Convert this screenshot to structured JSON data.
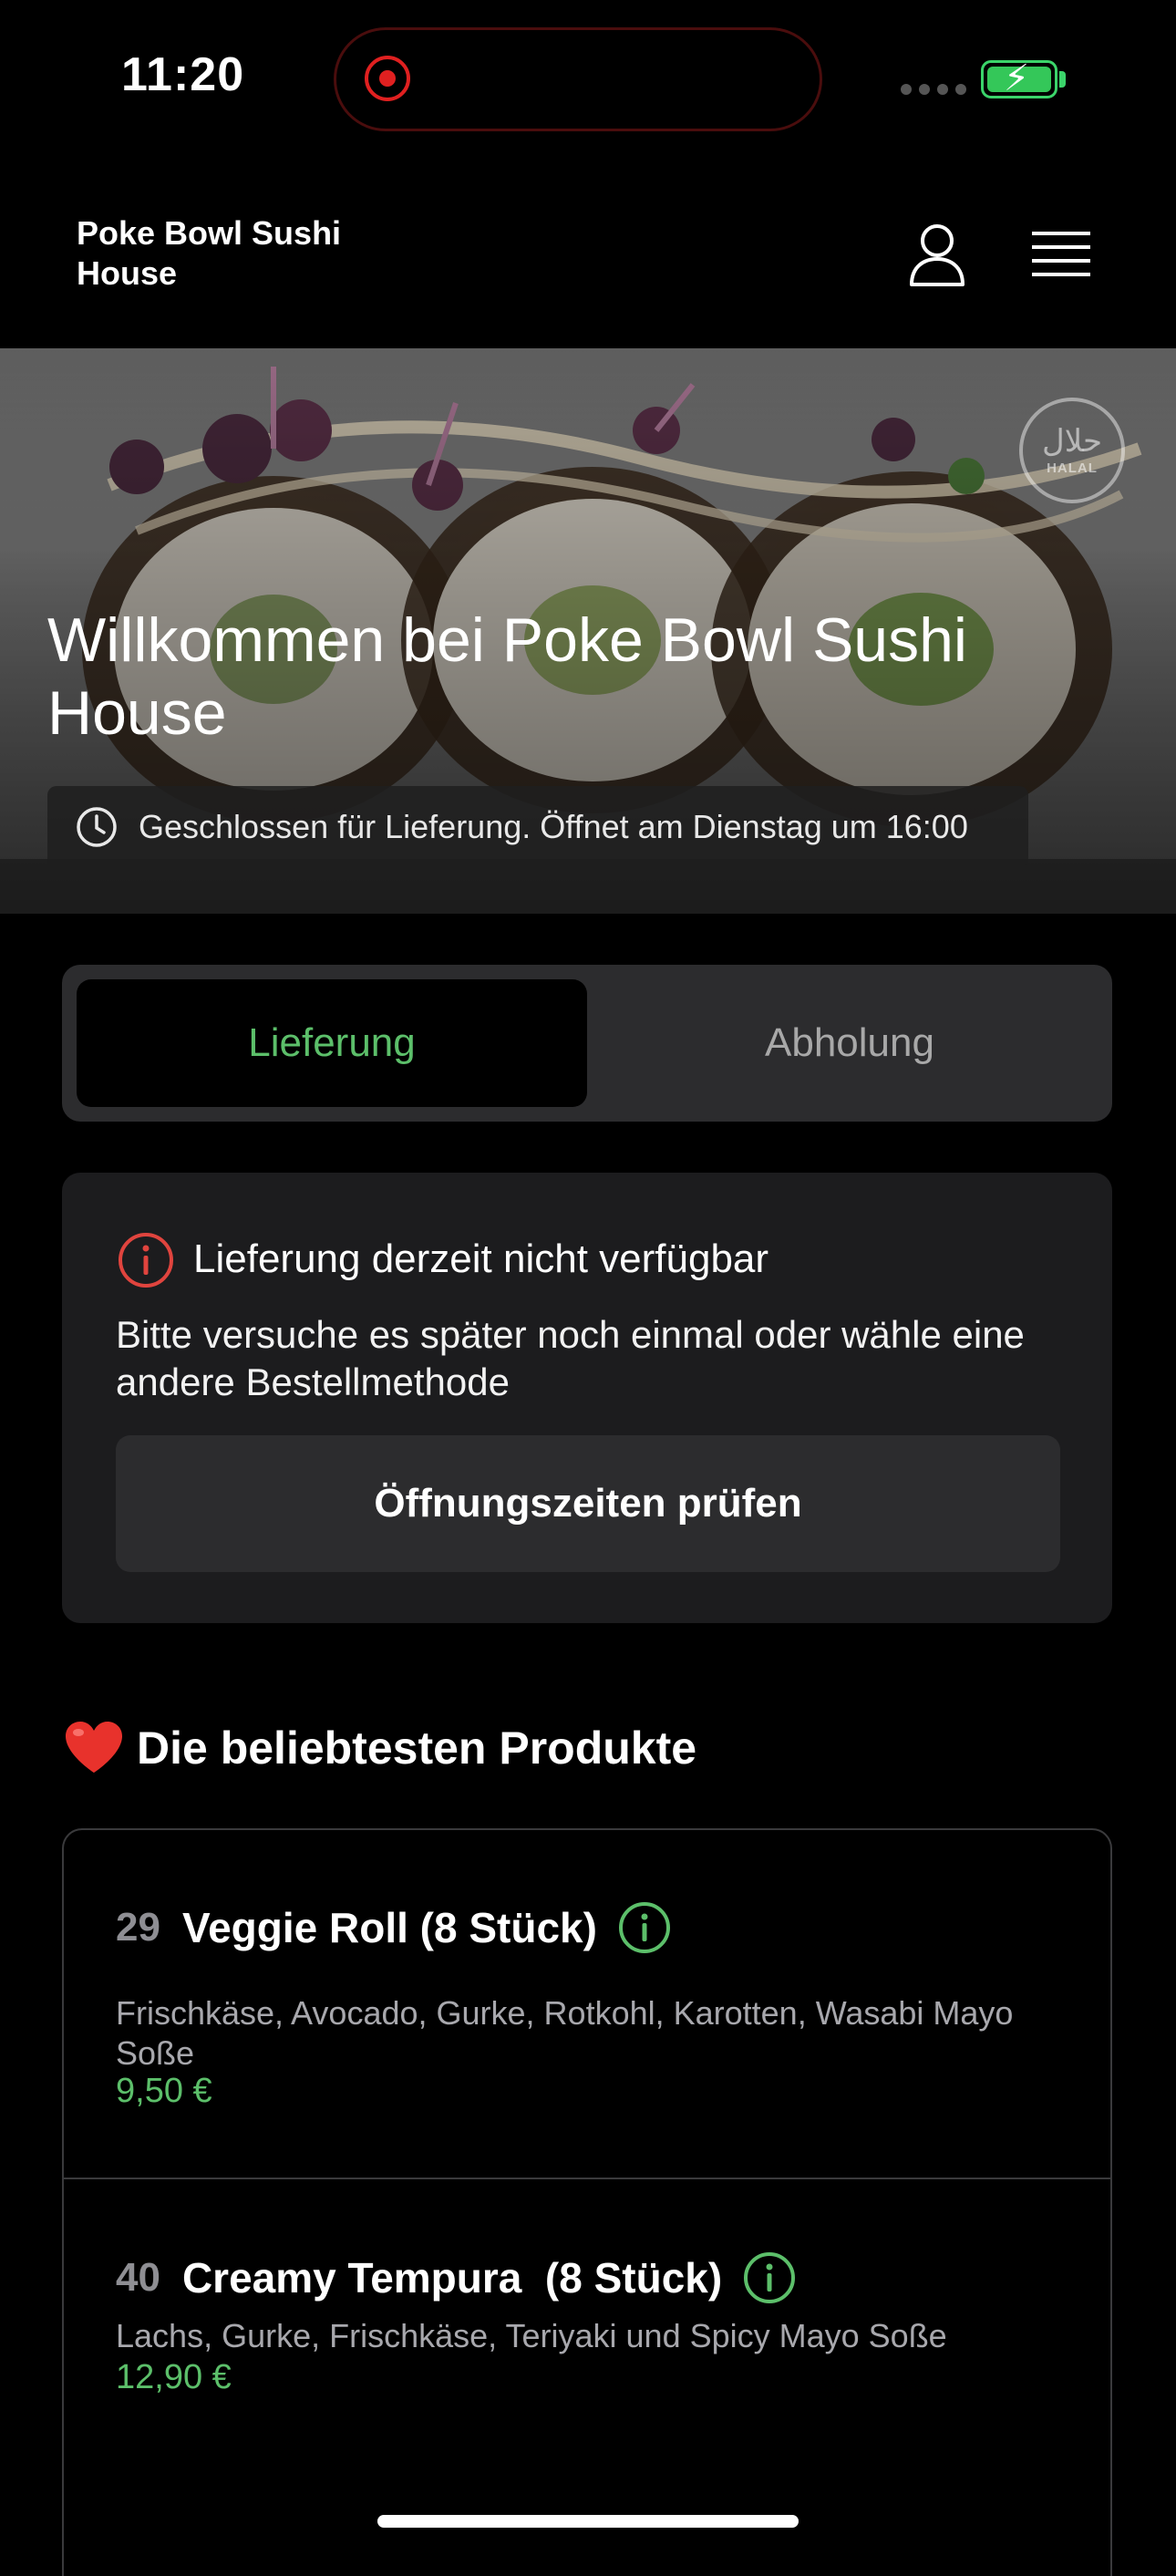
{
  "status_bar": {
    "time": "11:20"
  },
  "header": {
    "brand": "Poke Bowl Sushi House",
    "icons": [
      "user-icon",
      "menu-icon"
    ]
  },
  "hero": {
    "title": "Willkommen bei Poke Bowl Sushi House",
    "closed_notice": "Geschlossen für Lieferung. Öffnet am Dienstag um 16:00",
    "badge": {
      "arabic": "حلال",
      "latin": "HALAL"
    }
  },
  "order_mode": {
    "options": [
      "Lieferung",
      "Abholung"
    ],
    "selected": "Lieferung"
  },
  "notice": {
    "title": "Lieferung derzeit nicht verfügbar",
    "body": "Bitte versuche es später noch einmal oder wähle eine andere Bestellmethode",
    "button": "Öffnungszeiten prüfen"
  },
  "popular": {
    "title": "Die beliebtesten Produkte",
    "products": [
      {
        "number": "29",
        "name": "Veggie Roll (8 Stück)",
        "description": "Frischkäse, Avocado, Gurke, Rotkohl, Karotten, Wasabi Mayo Soße",
        "price": "9,50 €"
      },
      {
        "number": "40",
        "name": "Creamy Tempura  (8 Stück)",
        "description": "Lachs, Gurke, Frischkäse, Teriyaki und Spicy Mayo Soße",
        "price": "12,90 €"
      }
    ]
  },
  "colors": {
    "accent_green": "#5cbf6a",
    "alert_red": "#e0443e",
    "background": "#000000",
    "card": "#1c1c1e"
  }
}
